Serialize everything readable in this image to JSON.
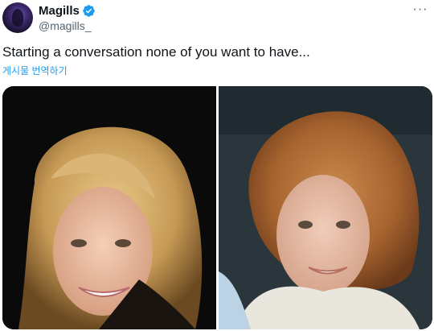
{
  "tweet": {
    "author": {
      "display_name": "Magills",
      "handle": "@magills_",
      "verified": true,
      "verified_color": "#1d9bf0"
    },
    "more_label": "···",
    "text": "Starting a conversation none of you want to have...",
    "translate_label": "게시물 번역하기",
    "media": [
      {
        "icon": "photo",
        "description_name": "photo-left"
      },
      {
        "icon": "photo",
        "description_name": "photo-right"
      }
    ]
  },
  "colors": {
    "link": "#1d9bf0",
    "secondary_text": "#536471",
    "primary_text": "#0f1419"
  }
}
